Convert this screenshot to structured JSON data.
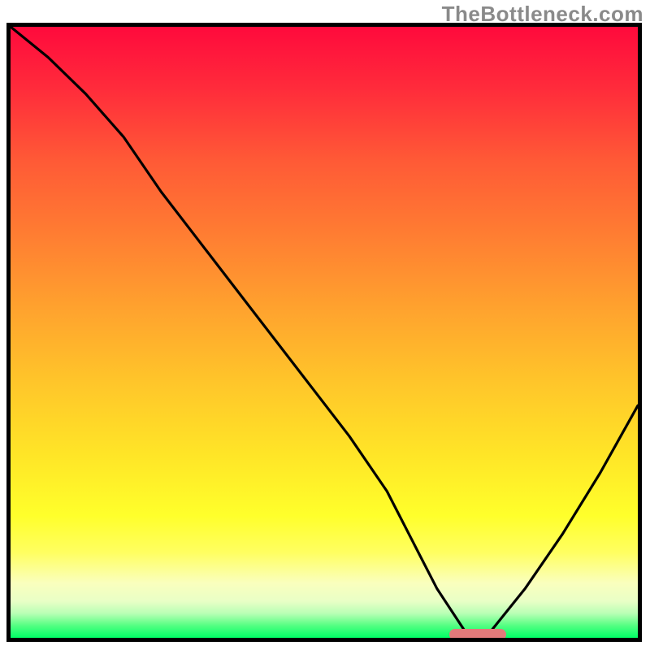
{
  "watermark": "TheBottleneck.com",
  "colors": {
    "top": "#ff0a3c",
    "mid": "#ffc52a",
    "bottom": "#00ff66",
    "curve": "#000000",
    "marker": "#e27a7a",
    "border": "#000000"
  },
  "chart_data": {
    "type": "line",
    "title": "",
    "xlabel": "",
    "ylabel": "",
    "xlim": [
      0,
      100
    ],
    "ylim": [
      0,
      100
    ],
    "grid": false,
    "legend": false,
    "series": [
      {
        "name": "bottleneck-curve",
        "x": [
          0,
          6,
          12,
          18,
          24,
          30,
          36,
          42,
          48,
          54,
          60,
          64,
          68,
          72.5,
          76.5,
          82,
          88,
          94,
          100
        ],
        "y": [
          100,
          95,
          89,
          82,
          73,
          65,
          57,
          49,
          41,
          33,
          24,
          16,
          8,
          1,
          1,
          8,
          17,
          27,
          38
        ]
      }
    ],
    "annotations": [
      {
        "name": "optimal-marker",
        "x_start": 70,
        "x_end": 79,
        "y": 0
      }
    ]
  }
}
